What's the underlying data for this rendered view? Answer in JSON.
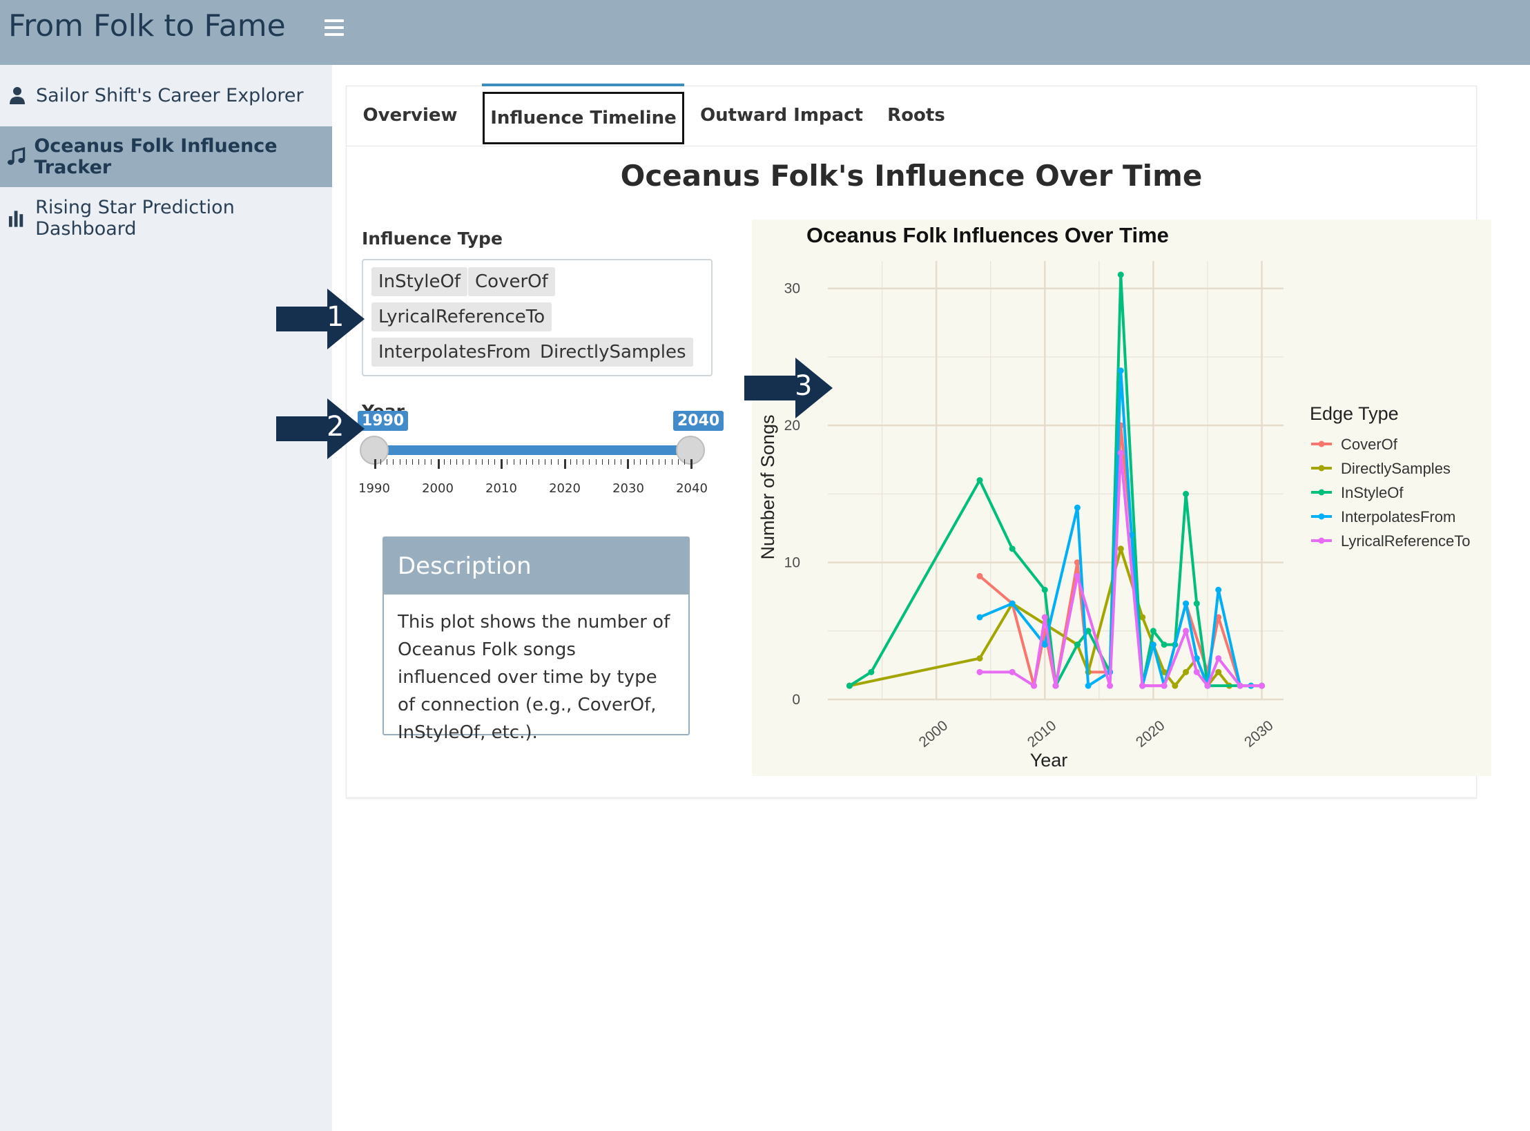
{
  "app": {
    "title": "From Folk to Fame"
  },
  "sidebar": {
    "items": [
      {
        "label": "Sailor Shift's Career Explorer",
        "icon": "user-icon",
        "active": false
      },
      {
        "label": "Oceanus Folk Influence Tracker",
        "icon": "music-icon",
        "active": true
      },
      {
        "label": "Rising Star Prediction Dashboard",
        "icon": "bar-chart-icon",
        "active": false
      }
    ]
  },
  "tabs": [
    "Overview",
    "Influence Timeline",
    "Outward Impact",
    "Roots"
  ],
  "active_tab": "Influence Timeline",
  "main": {
    "title": "Oceanus Folk's Influence Over Time",
    "influence_label": "Influence Type",
    "influence_selected": [
      "InStyleOf",
      "CoverOf",
      "LyricalReferenceTo",
      "InterpolatesFrom",
      "DirectlySamples"
    ],
    "year_label": "Year",
    "year_min": "1990",
    "year_max": "2040",
    "year_ticks": [
      "1990",
      "2000",
      "2010",
      "2020",
      "2030",
      "2040"
    ],
    "description_title": "Description",
    "description_text": "This plot shows the number of Oceanus Folk songs influenced over time by type of connection (e.g., CoverOf, InStyleOf, etc.)."
  },
  "callouts": [
    "1",
    "2",
    "3"
  ],
  "colors": {
    "header": "#98aebf",
    "accent": "#428bca",
    "CoverOf": "#f8766d",
    "DirectlySamples": "#a3a500",
    "InStyleOf": "#00bf7d",
    "InterpolatesFrom": "#00b0f6",
    "LyricalReferenceTo": "#e76bf3",
    "callout": "#15304f"
  },
  "chart_data": {
    "type": "line",
    "title": "Oceanus Folk Influences Over Time",
    "xlabel": "Year",
    "ylabel": "Number of Songs",
    "xlim": [
      1990,
      2032
    ],
    "ylim": [
      0,
      32
    ],
    "xticks": [
      2000,
      2010,
      2020,
      2030
    ],
    "yticks": [
      0,
      10,
      20,
      30
    ],
    "legend_title": "Edge Type",
    "legend_position": "right",
    "grid": true,
    "series": [
      {
        "name": "CoverOf",
        "x": [
          2004,
          2007,
          2009,
          2010,
          2011,
          2013,
          2014,
          2016,
          2017,
          2018,
          2019,
          2021,
          2023,
          2025,
          2026,
          2028,
          2030
        ],
        "y": [
          9,
          7,
          1,
          5,
          1,
          10,
          2,
          2,
          20,
          12,
          1,
          1,
          7,
          2,
          6,
          1,
          1
        ]
      },
      {
        "name": "DirectlySamples",
        "x": [
          1992,
          2004,
          2007,
          2013,
          2014,
          2017,
          2019,
          2021,
          2022,
          2023,
          2024,
          2025,
          2026,
          2027
        ],
        "y": [
          1,
          3,
          7,
          4,
          2,
          11,
          6,
          2,
          1,
          2,
          3,
          1,
          2,
          1
        ]
      },
      {
        "name": "InStyleOf",
        "x": [
          1992,
          1994,
          2004,
          2007,
          2010,
          2011,
          2013,
          2014,
          2016,
          2017,
          2019,
          2020,
          2021,
          2022,
          2023,
          2024,
          2025,
          2029,
          2030
        ],
        "y": [
          1,
          2,
          16,
          11,
          8,
          1,
          4,
          5,
          2,
          31,
          1,
          5,
          4,
          4,
          15,
          7,
          1,
          1,
          1
        ]
      },
      {
        "name": "InterpolatesFrom",
        "x": [
          2004,
          2007,
          2010,
          2013,
          2014,
          2016,
          2017,
          2018,
          2019,
          2020,
          2021,
          2023,
          2024,
          2025,
          2026,
          2028,
          2029
        ],
        "y": [
          6,
          7,
          4,
          14,
          1,
          2,
          24,
          12,
          1,
          4,
          1,
          7,
          3,
          1,
          8,
          1,
          1
        ]
      },
      {
        "name": "LyricalReferenceTo",
        "x": [
          2004,
          2007,
          2009,
          2010,
          2011,
          2013,
          2016,
          2017,
          2019,
          2021,
          2023,
          2024,
          2025,
          2026,
          2028,
          2030
        ],
        "y": [
          2,
          2,
          1,
          6,
          1,
          9,
          1,
          18,
          1,
          1,
          5,
          2,
          1,
          3,
          1,
          1
        ]
      }
    ]
  }
}
